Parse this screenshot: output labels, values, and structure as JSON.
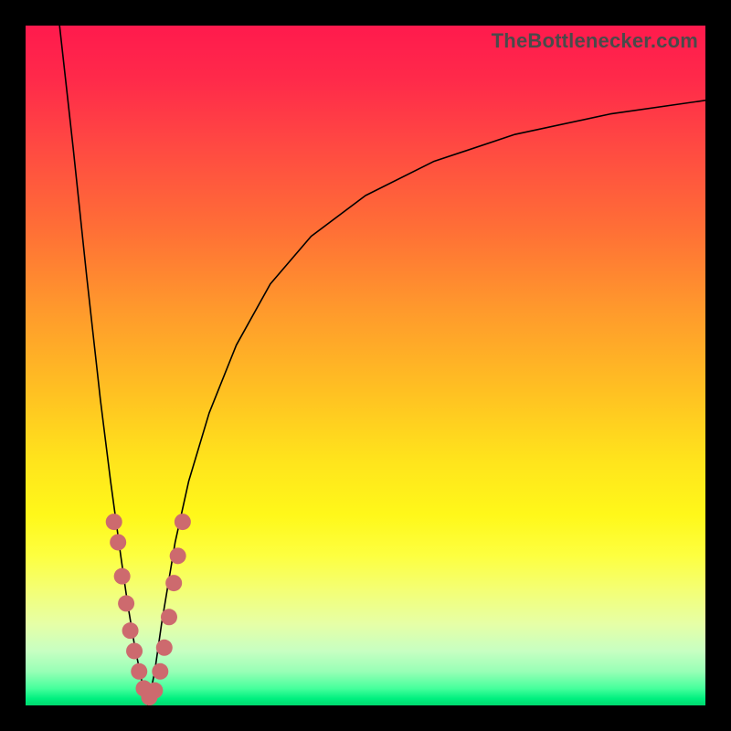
{
  "watermark": {
    "text": "TheBottlenecker.com"
  },
  "colors": {
    "frame": "#000000",
    "dot": "#cd6a6e",
    "curve": "#000000"
  },
  "chart_data": {
    "type": "line",
    "title": "",
    "xlabel": "",
    "ylabel": "",
    "xlim": [
      0,
      100
    ],
    "ylim": [
      0,
      100
    ],
    "description": "Bottleneck curve with minimum near x≈18; overlaid dots mark near-minimum region on both branches.",
    "series": [
      {
        "name": "bottleneck-curve-left",
        "x": [
          5,
          7,
          9,
          11,
          12.5,
          14,
          15,
          16,
          17,
          18
        ],
        "values": [
          100,
          82,
          63,
          45,
          33,
          22,
          15,
          9,
          4,
          0
        ]
      },
      {
        "name": "bottleneck-curve-right",
        "x": [
          18,
          19,
          20,
          22,
          24,
          27,
          31,
          36,
          42,
          50,
          60,
          72,
          86,
          100
        ],
        "values": [
          0,
          5,
          12,
          24,
          33,
          43,
          53,
          62,
          69,
          75,
          80,
          84,
          87,
          89
        ]
      }
    ],
    "dots": {
      "name": "marker-dots",
      "points": [
        {
          "x": 13.0,
          "y": 27
        },
        {
          "x": 13.6,
          "y": 24
        },
        {
          "x": 14.2,
          "y": 19
        },
        {
          "x": 14.8,
          "y": 15
        },
        {
          "x": 15.4,
          "y": 11
        },
        {
          "x": 16.0,
          "y": 8
        },
        {
          "x": 16.7,
          "y": 5
        },
        {
          "x": 17.4,
          "y": 2.5
        },
        {
          "x": 18.2,
          "y": 1.2
        },
        {
          "x": 19.0,
          "y": 2.2
        },
        {
          "x": 19.8,
          "y": 5
        },
        {
          "x": 20.4,
          "y": 8.5
        },
        {
          "x": 21.1,
          "y": 13
        },
        {
          "x": 21.8,
          "y": 18
        },
        {
          "x": 22.4,
          "y": 22
        },
        {
          "x": 23.1,
          "y": 27
        }
      ],
      "radius": 9
    }
  }
}
